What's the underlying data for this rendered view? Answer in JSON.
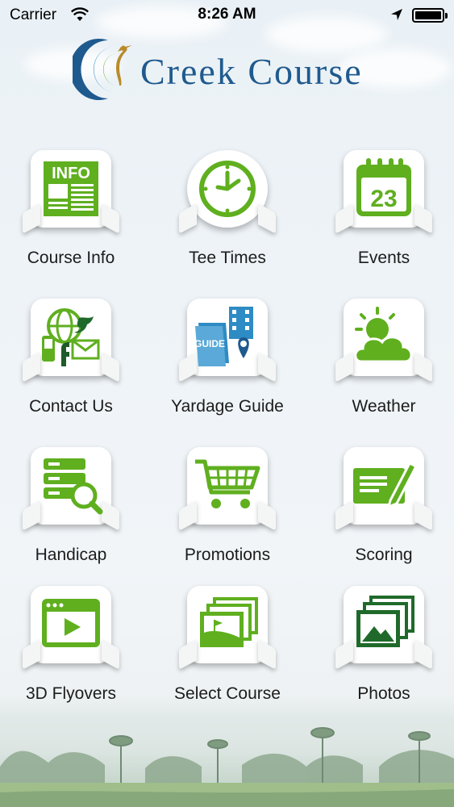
{
  "status_bar": {
    "carrier": "Carrier",
    "time": "8:26 AM",
    "icons": [
      "wifi-icon",
      "location-arrow-icon",
      "battery-icon"
    ]
  },
  "header": {
    "title": "Creek Course",
    "logo_icon": "heron-logo-icon"
  },
  "colors": {
    "accent_green": "#5faf1f",
    "brand_blue": "#1f5a8e",
    "card_bg": "#ffffff"
  },
  "menu": {
    "items": [
      {
        "label": "Course Info",
        "icon": "info-newspaper-icon"
      },
      {
        "label": "Tee Times",
        "icon": "clock-icon"
      },
      {
        "label": "Events",
        "icon": "calendar-icon"
      },
      {
        "label": "Contact Us",
        "icon": "contact-social-icon"
      },
      {
        "label": "Yardage Guide",
        "icon": "guide-map-icon"
      },
      {
        "label": "Weather",
        "icon": "weather-cloud-sun-icon"
      },
      {
        "label": "Handicap",
        "icon": "database-search-icon"
      },
      {
        "label": "Promotions",
        "icon": "shopping-cart-icon"
      },
      {
        "label": "Scoring",
        "icon": "scorecard-pen-icon"
      },
      {
        "label": "3D Flyovers",
        "icon": "video-play-icon"
      },
      {
        "label": "Select Course",
        "icon": "course-photos-icon"
      },
      {
        "label": "Photos",
        "icon": "photo-stack-icon"
      }
    ],
    "calendar_day": "23",
    "info_text": "INFO",
    "guide_text": "GUIDE"
  }
}
